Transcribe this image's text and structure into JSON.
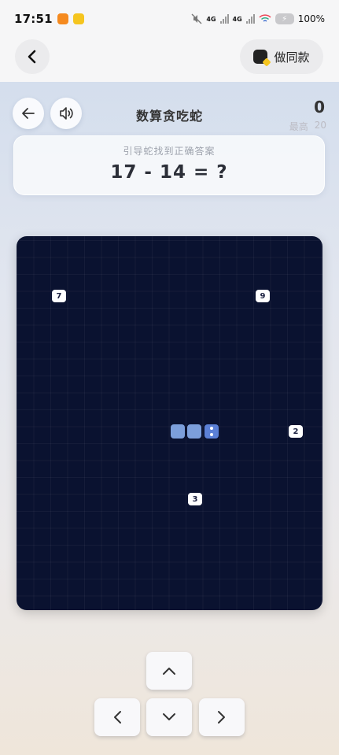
{
  "status_bar": {
    "time": "17:51",
    "network_1": "4G",
    "network_2": "4G",
    "battery": "100%"
  },
  "top_bar": {
    "make_same_label": "做同款"
  },
  "game": {
    "title": "数算贪吃蛇",
    "score": "0",
    "best_label": "最高",
    "best_value": "20"
  },
  "question": {
    "hint": "引导蛇找到正确答案",
    "expression": "17 - 14 = ?"
  },
  "board": {
    "tiles": [
      {
        "value": "7"
      },
      {
        "value": "9"
      },
      {
        "value": "2"
      },
      {
        "value": "3"
      }
    ],
    "snake_length": 3
  },
  "colors": {
    "board_background": "#0a1230",
    "snake_body": "#7c9fdb",
    "snake_head": "#5b80d6",
    "tile_background": "#ffffff"
  },
  "icons": {
    "back": "arrow-left-icon",
    "sound": "speaker-icon",
    "make_same": "sticker-icon",
    "up": "chevron-up-icon",
    "left": "chevron-left-icon",
    "down": "chevron-down-icon",
    "right": "chevron-right-icon"
  }
}
